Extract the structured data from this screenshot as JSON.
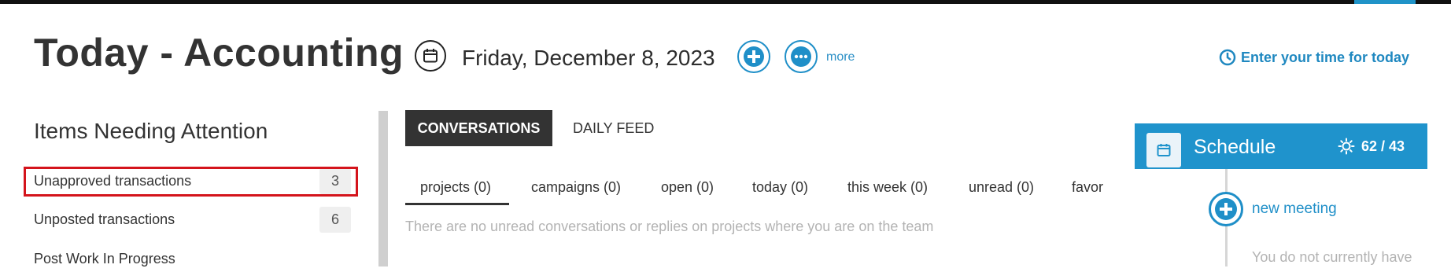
{
  "header": {
    "title": "Today - Accounting",
    "date": "Friday, December 8, 2023",
    "more_label": "more",
    "time_link": "Enter your time for today"
  },
  "attention": {
    "title": "Items Needing Attention",
    "items": [
      {
        "label": "Unapproved transactions",
        "count": "3"
      },
      {
        "label": "Unposted transactions",
        "count": "6"
      },
      {
        "label": "Post Work In Progress",
        "count": ""
      }
    ]
  },
  "main": {
    "tabs": [
      {
        "label": "CONVERSATIONS",
        "active": true
      },
      {
        "label": "DAILY FEED",
        "active": false
      }
    ],
    "filters": [
      "projects (0)",
      "campaigns (0)",
      "open (0)",
      "today (0)",
      "this week (0)",
      "unread (0)",
      "favor"
    ],
    "empty_message": "There are no unread conversations or replies on projects where you are on the team"
  },
  "schedule": {
    "title": "Schedule",
    "stat": "62 / 43",
    "new_meeting": "new meeting",
    "message": "You do not currently have"
  },
  "icons": {
    "calendar": "calendar-icon",
    "add": "plus-icon",
    "more": "ellipsis-icon",
    "clock": "clock-icon",
    "sun": "sun-icon"
  },
  "colors": {
    "accent": "#1f93cc",
    "highlight": "#d4141c",
    "dark_tab": "#333333",
    "muted_text": "#b3b3b3"
  }
}
